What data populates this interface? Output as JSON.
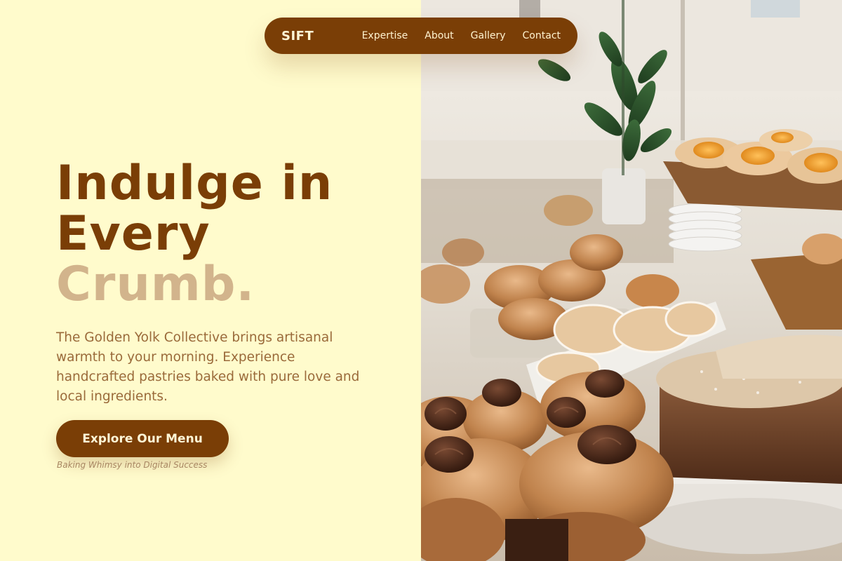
{
  "nav": {
    "brand": "SIFT",
    "links": [
      "Expertise",
      "About",
      "Gallery",
      "Contact"
    ]
  },
  "hero": {
    "title_line1": "Indulge in",
    "title_line2": "Every",
    "title_line3": "Crumb.",
    "description": "The Golden Yolk Collective brings artisanal warmth to your morning. Experience handcrafted pastries baked with pure love and local ingredients.",
    "cta_label": "Explore Our Menu",
    "tagline": "Baking Whimsy into Digital Success"
  },
  "colors": {
    "background": "#FFFBCC",
    "brand_brown": "#7A3E06",
    "accent_tan": "#D2B48C",
    "body_text": "#9A6A3A"
  },
  "image": {
    "subject": "bakery-pastry-display"
  }
}
